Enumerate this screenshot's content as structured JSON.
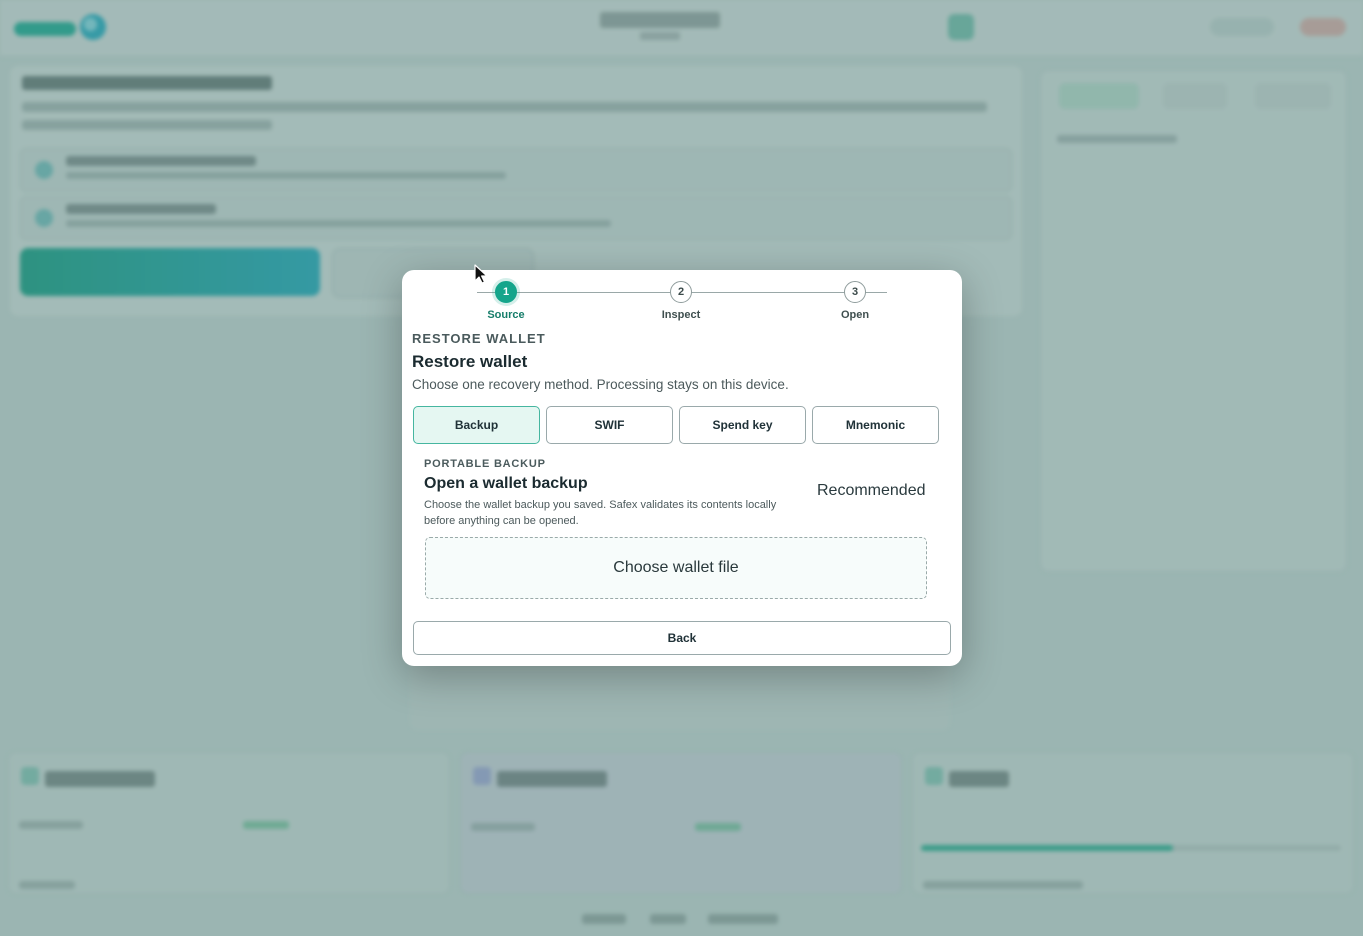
{
  "colors": {
    "accent": "#15a58b",
    "selected_bg": "#e5f7f2",
    "scrim": "rgba(70,110,105,0.38)"
  },
  "stepper": {
    "steps": [
      {
        "number": "1",
        "label": "Source",
        "state": "active"
      },
      {
        "number": "2",
        "label": "Inspect",
        "state": "pending"
      },
      {
        "number": "3",
        "label": "Open",
        "state": "pending"
      }
    ]
  },
  "dialog": {
    "eyebrow": "RESTORE WALLET",
    "title": "Restore wallet",
    "subtitle": "Choose one recovery method. Processing stays on this device.",
    "methods": [
      {
        "label": "Backup",
        "selected": true
      },
      {
        "label": "SWIF",
        "selected": false
      },
      {
        "label": "Spend key",
        "selected": false
      },
      {
        "label": "Mnemonic",
        "selected": false
      }
    ],
    "portable_backup": {
      "eyebrow": "PORTABLE BACKUP",
      "title": "Open a wallet backup",
      "description": "Choose the wallet backup you saved. Safex validates its contents locally before anything can be opened.",
      "badge": "Recommended",
      "dropzone_label": "Choose wallet file"
    },
    "back_label": "Back"
  }
}
